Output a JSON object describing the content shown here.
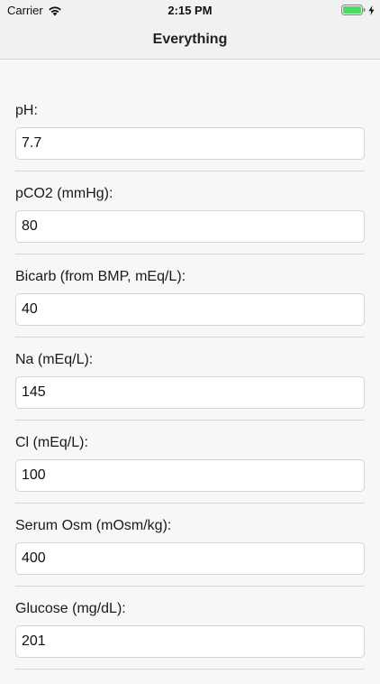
{
  "status_bar": {
    "carrier": "Carrier",
    "time": "2:15 PM",
    "wifi_icon": "wifi-icon",
    "battery_icon": "battery-icon",
    "battery_color": "#4cd964"
  },
  "nav": {
    "title": "Everything"
  },
  "fields": [
    {
      "label": "pH:",
      "value": "7.7"
    },
    {
      "label": "pCO2 (mmHg):",
      "value": "80"
    },
    {
      "label": "Bicarb (from BMP, mEq/L):",
      "value": "40"
    },
    {
      "label": "Na (mEq/L):",
      "value": "145"
    },
    {
      "label": "Cl (mEq/L):",
      "value": "100"
    },
    {
      "label": "Serum Osm (mOsm/kg):",
      "value": "400"
    },
    {
      "label": "Glucose (mg/dL):",
      "value": "201"
    }
  ]
}
